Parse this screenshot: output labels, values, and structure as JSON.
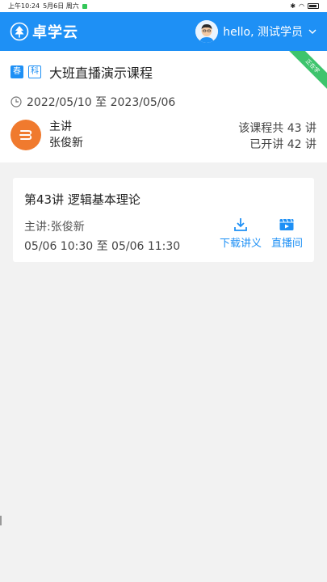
{
  "status_bar": {
    "time": "上午10:24",
    "date": "5月6日 周六"
  },
  "header": {
    "logo_text": "卓学云",
    "greeting": "hello, 测试学员"
  },
  "course": {
    "tag_season": "春",
    "tag_subject": "科",
    "title": "大班直播演示课程",
    "ribbon": "正在学",
    "date_range": "2022/05/10 至 2023/05/06",
    "teacher_role": "主讲",
    "teacher_name": "张俊新",
    "total_lessons": "该课程共 43 讲",
    "done_lessons": "已开讲 42 讲"
  },
  "lesson": {
    "title": "第43讲 逻辑基本理论",
    "teacher": "主讲:张俊新",
    "time": "05/06 10:30 至 05/06 11:30",
    "download_label": "下载讲义",
    "live_label": "直播间"
  },
  "colors": {
    "brand_blue": "#1e90f5",
    "ribbon_green": "#3ec46d",
    "teacher_avatar_orange": "#f07a2e"
  }
}
